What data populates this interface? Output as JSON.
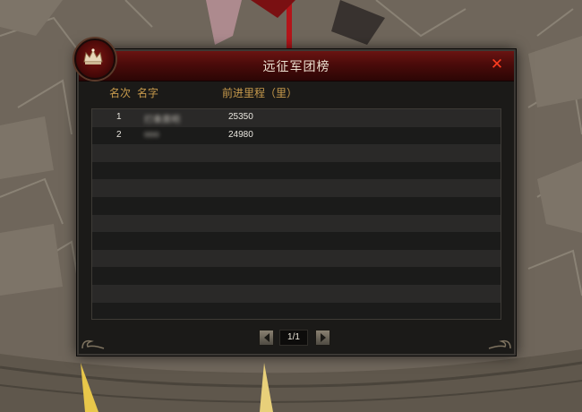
{
  "dialog": {
    "title": "远征军团榜",
    "close_icon": "close-x-icon",
    "emblem_icon": "crown-icon"
  },
  "columns": {
    "rank": "名次",
    "name": "名字",
    "distance": "前进里程（里）"
  },
  "rows": [
    {
      "rank": "1",
      "name": "打奏黄明",
      "distance": "25350"
    },
    {
      "rank": "2",
      "name": "ooo",
      "distance": "24980"
    }
  ],
  "pager": {
    "page_indicator": "1/1",
    "prev_icon": "arrow-left-icon",
    "next_icon": "arrow-right-icon"
  },
  "colors": {
    "title_bar": "#4a0b0a",
    "header_text": "#c79a4c",
    "close": "#ff3d1f"
  }
}
